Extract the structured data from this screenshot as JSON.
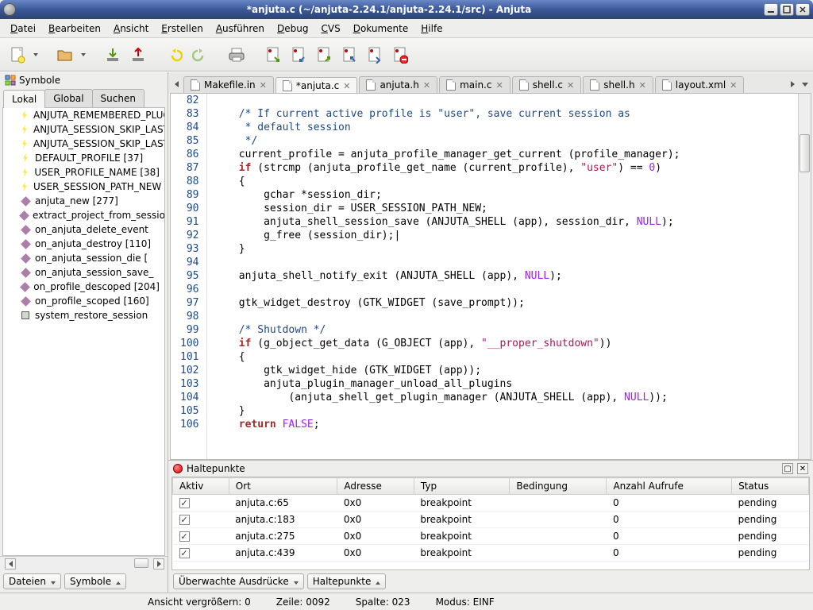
{
  "window": {
    "title": "*anjuta.c (~/anjuta-2.24.1/anjuta-2.24.1/src) - Anjuta"
  },
  "menubar": {
    "items": [
      {
        "label": "Datei",
        "accel": "D"
      },
      {
        "label": "Bearbeiten",
        "accel": "B"
      },
      {
        "label": "Ansicht",
        "accel": "A"
      },
      {
        "label": "Erstellen",
        "accel": "E"
      },
      {
        "label": "Ausführen",
        "accel": "A"
      },
      {
        "label": "Debug",
        "accel": "D"
      },
      {
        "label": "CVS",
        "accel": "C"
      },
      {
        "label": "Dokumente",
        "accel": "D"
      },
      {
        "label": "Hilfe",
        "accel": "H"
      }
    ]
  },
  "sidebar": {
    "title": "Symbole",
    "tabs": [
      "Lokal",
      "Global",
      "Suchen"
    ],
    "activeTab": 0,
    "items": [
      {
        "icon": "bolt",
        "label": "ANJUTA_REMEMBERED_PLUGINS"
      },
      {
        "icon": "bolt",
        "label": "ANJUTA_SESSION_SKIP_LAST"
      },
      {
        "icon": "bolt",
        "label": "ANJUTA_SESSION_SKIP_LAST_FILES"
      },
      {
        "icon": "bolt",
        "label": "DEFAULT_PROFILE [37]"
      },
      {
        "icon": "bolt",
        "label": "USER_PROFILE_NAME [38]"
      },
      {
        "icon": "bolt",
        "label": "USER_SESSION_PATH_NEW"
      },
      {
        "icon": "diamond",
        "label": "anjuta_new [277]"
      },
      {
        "icon": "diamond",
        "label": "extract_project_from_session"
      },
      {
        "icon": "diamond",
        "label": "on_anjuta_delete_event"
      },
      {
        "icon": "diamond",
        "label": "on_anjuta_destroy [110]"
      },
      {
        "icon": "diamond",
        "label": "on_anjuta_session_die ["
      },
      {
        "icon": "diamond",
        "label": "on_anjuta_session_save_"
      },
      {
        "icon": "diamond",
        "label": "on_profile_descoped [204]"
      },
      {
        "icon": "diamond",
        "label": "on_profile_scoped [160]"
      },
      {
        "icon": "square",
        "label": "system_restore_session"
      }
    ],
    "footer": {
      "left": "Dateien",
      "right": "Symbole"
    }
  },
  "editor": {
    "tabs": [
      {
        "label": "Makefile.in",
        "active": false
      },
      {
        "label": "*anjuta.c",
        "active": true
      },
      {
        "label": "anjuta.h",
        "active": false
      },
      {
        "label": "main.c",
        "active": false
      },
      {
        "label": "shell.c",
        "active": false
      },
      {
        "label": "shell.h",
        "active": false
      },
      {
        "label": "layout.xml",
        "active": false
      }
    ],
    "startLine": 81,
    "code": [
      {
        "n": 82,
        "t": ""
      },
      {
        "n": 83,
        "t": "    /* If current active profile is \"user\", save current session as",
        "cls": "cm"
      },
      {
        "n": 84,
        "t": "     * default session",
        "cls": "cm"
      },
      {
        "n": 85,
        "t": "     */",
        "cls": "cm"
      },
      {
        "n": 86,
        "raw": "    current_profile = anjuta_profile_manager_get_current (profile_manager);"
      },
      {
        "n": 87,
        "raw": "    <span class='kw'>if</span> (strcmp (anjuta_profile_get_name (current_profile), <span class='str'>\"user\"</span>) == <span class='const'>0</span>)"
      },
      {
        "n": 88,
        "raw": "    {"
      },
      {
        "n": 89,
        "raw": "        gchar *session_dir;"
      },
      {
        "n": 90,
        "raw": "        session_dir = USER_SESSION_PATH_NEW;"
      },
      {
        "n": 91,
        "raw": "        anjuta_shell_session_save (ANJUTA_SHELL (app), session_dir, <span class='const'>NULL</span>);"
      },
      {
        "n": 92,
        "raw": "        g_free (session_dir);|"
      },
      {
        "n": 93,
        "raw": "    }"
      },
      {
        "n": 94,
        "raw": ""
      },
      {
        "n": 95,
        "raw": "    anjuta_shell_notify_exit (ANJUTA_SHELL (app), <span class='const'>NULL</span>);"
      },
      {
        "n": 96,
        "raw": ""
      },
      {
        "n": 97,
        "raw": "    gtk_widget_destroy (GTK_WIDGET (save_prompt));"
      },
      {
        "n": 98,
        "raw": ""
      },
      {
        "n": 99,
        "raw": "    <span class='cm'>/* Shutdown */</span>"
      },
      {
        "n": 100,
        "raw": "    <span class='kw'>if</span> (g_object_get_data (G_OBJECT (app), <span class='str'>\"__proper_shutdown\"</span>))"
      },
      {
        "n": 101,
        "raw": "    {"
      },
      {
        "n": 102,
        "raw": "        gtk_widget_hide (GTK_WIDGET (app));"
      },
      {
        "n": 103,
        "raw": "        anjuta_plugin_manager_unload_all_plugins"
      },
      {
        "n": 104,
        "raw": "            (anjuta_shell_get_plugin_manager (ANJUTA_SHELL (app), <span class='const'>NULL</span>));"
      },
      {
        "n": 105,
        "raw": "    }"
      },
      {
        "n": 106,
        "raw": "    <span class='kw'>return</span> <span class='const'>FALSE</span>;"
      }
    ]
  },
  "breakpoints": {
    "title": "Haltepunkte",
    "columns": [
      "Aktiv",
      "Ort",
      "Adresse",
      "Typ",
      "Bedingung",
      "Anzahl Aufrufe",
      "Status"
    ],
    "rows": [
      {
        "active": true,
        "loc": "anjuta.c:65",
        "addr": "0x0",
        "type": "breakpoint",
        "cond": "",
        "hits": "0",
        "status": "pending"
      },
      {
        "active": true,
        "loc": "anjuta.c:183",
        "addr": "0x0",
        "type": "breakpoint",
        "cond": "",
        "hits": "0",
        "status": "pending"
      },
      {
        "active": true,
        "loc": "anjuta.c:275",
        "addr": "0x0",
        "type": "breakpoint",
        "cond": "",
        "hits": "0",
        "status": "pending"
      },
      {
        "active": true,
        "loc": "anjuta.c:439",
        "addr": "0x0",
        "type": "breakpoint",
        "cond": "",
        "hits": "0",
        "status": "pending"
      }
    ],
    "footer": {
      "left": "Überwachte Ausdrücke",
      "right": "Haltepunkte"
    }
  },
  "statusbar": {
    "zoom": "Ansicht vergrößern: 0",
    "line": "Zeile: 0092",
    "col": "Spalte: 023",
    "mode": "Modus: EINF"
  }
}
